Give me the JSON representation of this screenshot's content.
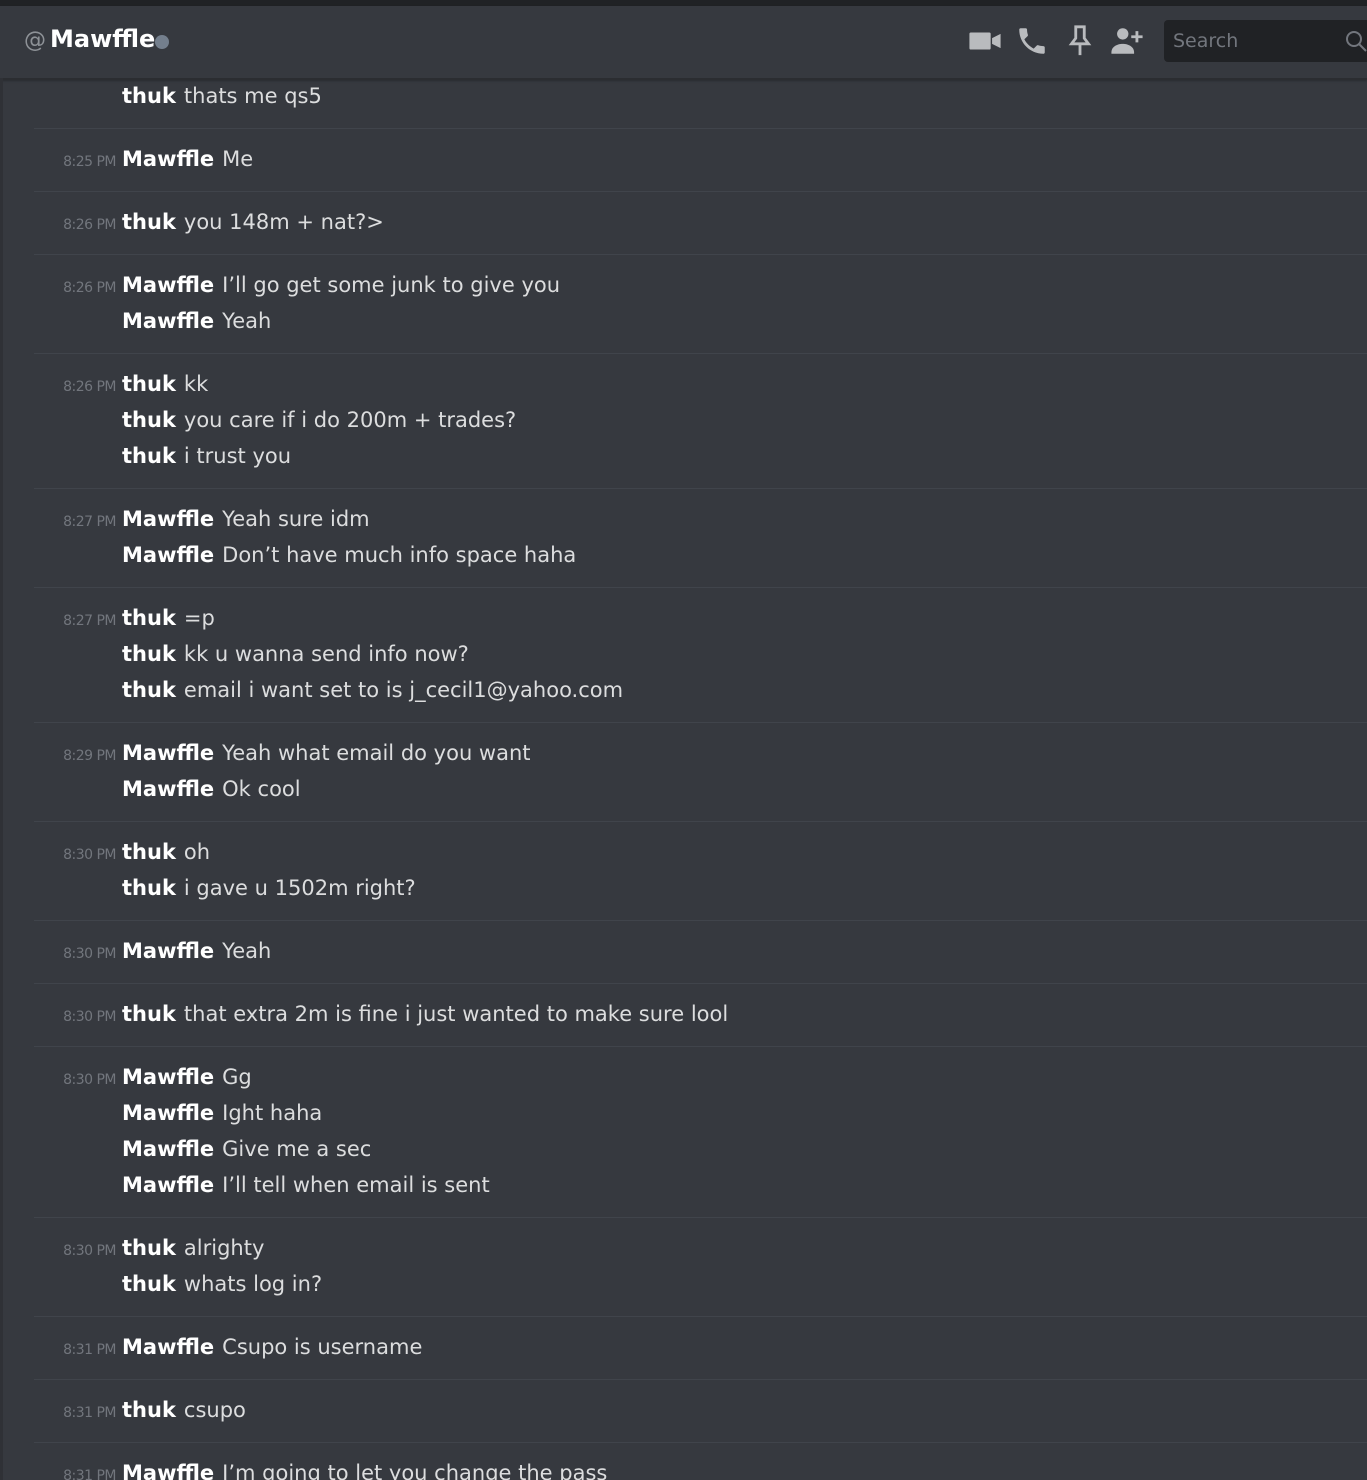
{
  "header": {
    "at_symbol": "@",
    "channel_name": "Mawffle",
    "search_placeholder": "Search",
    "icons": [
      "video-call-icon",
      "voice-call-icon",
      "pin-icon",
      "add-friend-icon",
      "search-icon"
    ],
    "colors": {
      "background": "#36393f",
      "status_offline": "#747f8d",
      "search_bg": "#202225"
    }
  },
  "messages": [
    {
      "time": "",
      "lines": [
        {
          "author": "thuk",
          "text": "thats me qs5"
        }
      ]
    },
    {
      "time": "8:25 PM",
      "lines": [
        {
          "author": "Mawffle",
          "text": "Me"
        }
      ]
    },
    {
      "time": "8:26 PM",
      "lines": [
        {
          "author": "thuk",
          "text": "you 148m + nat?>"
        }
      ]
    },
    {
      "time": "8:26 PM",
      "lines": [
        {
          "author": "Mawffle",
          "text": "I’ll go get some junk to give you"
        },
        {
          "author": "Mawffle",
          "text": "Yeah"
        }
      ]
    },
    {
      "time": "8:26 PM",
      "lines": [
        {
          "author": "thuk",
          "text": "kk"
        },
        {
          "author": "thuk",
          "text": "you care if i do 200m + trades?"
        },
        {
          "author": "thuk",
          "text": "i trust you"
        }
      ]
    },
    {
      "time": "8:27 PM",
      "lines": [
        {
          "author": "Mawffle",
          "text": "Yeah sure idm"
        },
        {
          "author": "Mawffle",
          "text": "Don’t have much info space haha"
        }
      ]
    },
    {
      "time": "8:27 PM",
      "lines": [
        {
          "author": "thuk",
          "text": "=p"
        },
        {
          "author": "thuk",
          "text": "kk u wanna send info  now?"
        },
        {
          "author": "thuk",
          "text": "email i want set to is j_cecil1@yahoo.com"
        }
      ]
    },
    {
      "time": "8:29 PM",
      "lines": [
        {
          "author": "Mawffle",
          "text": "Yeah what email do you want"
        },
        {
          "author": "Mawffle",
          "text": "Ok cool"
        }
      ]
    },
    {
      "time": "8:30 PM",
      "lines": [
        {
          "author": "thuk",
          "text": "oh"
        },
        {
          "author": "thuk",
          "text": "i gave u 1502m right?"
        }
      ]
    },
    {
      "time": "8:30 PM",
      "lines": [
        {
          "author": "Mawffle",
          "text": "Yeah"
        }
      ]
    },
    {
      "time": "8:30 PM",
      "lines": [
        {
          "author": "thuk",
          "text": "that extra 2m is fine i just wanted to make sure lool"
        }
      ]
    },
    {
      "time": "8:30 PM",
      "lines": [
        {
          "author": "Mawffle",
          "text": "Gg"
        },
        {
          "author": "Mawffle",
          "text": "Ight haha"
        },
        {
          "author": "Mawffle",
          "text": "Give me a sec"
        },
        {
          "author": "Mawffle",
          "text": "I’ll tell when email is sent"
        }
      ]
    },
    {
      "time": "8:30 PM",
      "lines": [
        {
          "author": "thuk",
          "text": "alrighty"
        },
        {
          "author": "thuk",
          "text": "whats log in?"
        }
      ]
    },
    {
      "time": "8:31 PM",
      "lines": [
        {
          "author": "Mawffle",
          "text": "Csupo is username"
        }
      ]
    },
    {
      "time": "8:31 PM",
      "lines": [
        {
          "author": "thuk",
          "text": "csupo"
        }
      ]
    },
    {
      "time": "8:31 PM",
      "lines": [
        {
          "author": "Mawffle",
          "text": "I’m going to let you change the pass"
        }
      ]
    }
  ]
}
